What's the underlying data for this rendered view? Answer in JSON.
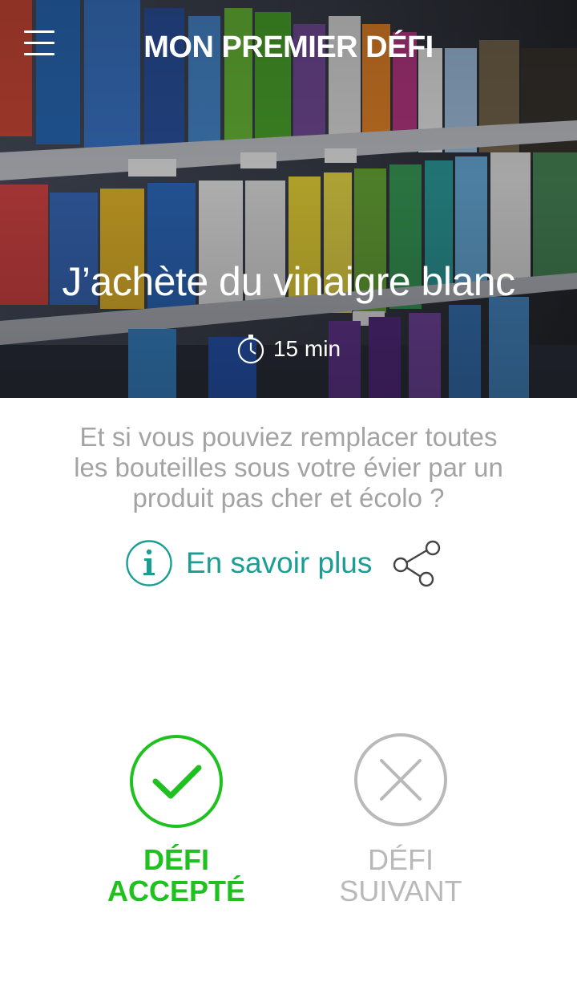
{
  "header": {
    "title": "MON PREMIER DÉFI",
    "menu_icon": "hamburger-menu-icon"
  },
  "challenge": {
    "title": "J’achète du vinaigre blanc",
    "duration": "15 min",
    "duration_icon": "stopwatch-icon",
    "description_lines": [
      "Et si vous pouviez remplacer toutes",
      "les bouteilles sous votre évier par un",
      "produit pas cher et écolo ?"
    ]
  },
  "more_info": {
    "label": "En savoir plus",
    "icon": "info-circle-icon",
    "share_icon": "share-icon"
  },
  "actions": {
    "accept": {
      "line1": "DÉFI",
      "line2": "ACCEPTÉ",
      "icon": "checkmark-circle-icon"
    },
    "skip": {
      "line1": "DÉFI",
      "line2": "SUIVANT",
      "icon": "close-circle-icon"
    }
  },
  "colors": {
    "accent_teal": "#1a9e94",
    "accept_green": "#1fc11f",
    "muted_grey": "#b9b9b9",
    "description_grey": "#a3a3a3"
  }
}
